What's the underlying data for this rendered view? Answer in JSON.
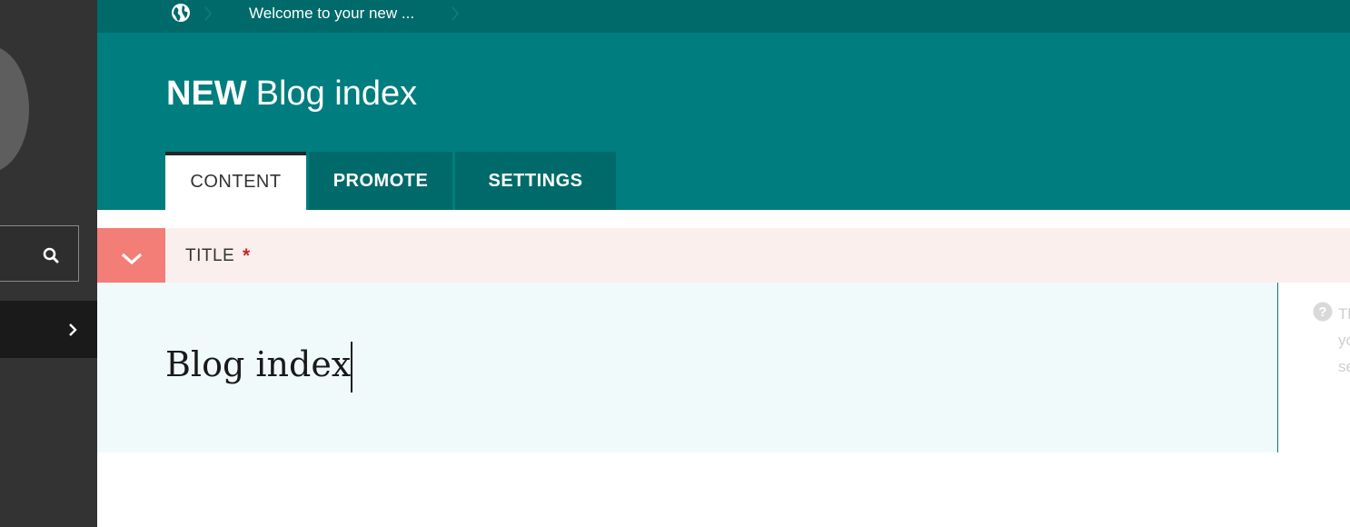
{
  "breadcrumb": {
    "home_icon": "globe-icon",
    "current_page": "Welcome to your new ..."
  },
  "page": {
    "status": "NEW",
    "title": "Blog index"
  },
  "tabs": [
    {
      "label": "CONTENT",
      "active": true
    },
    {
      "label": "PROMOTE",
      "active": false
    },
    {
      "label": "SETTINGS",
      "active": false
    }
  ],
  "field": {
    "label": "TITLE",
    "required_marker": "*",
    "value": "Blog index",
    "help_text": "Th\nyo\nse",
    "help_icon": "question-circle-icon",
    "toggle_icon": "chevron-down-icon"
  },
  "sidebar": {
    "search_icon": "search-icon",
    "expand_icon": "chevron-right-icon"
  },
  "colors": {
    "sidebar": "#333333",
    "breadcrumb": "#006a6a",
    "header": "#007d7e",
    "error_panel": "#fbefee",
    "error_toggle": "#f37e77",
    "field_body": "#f0fafb"
  }
}
